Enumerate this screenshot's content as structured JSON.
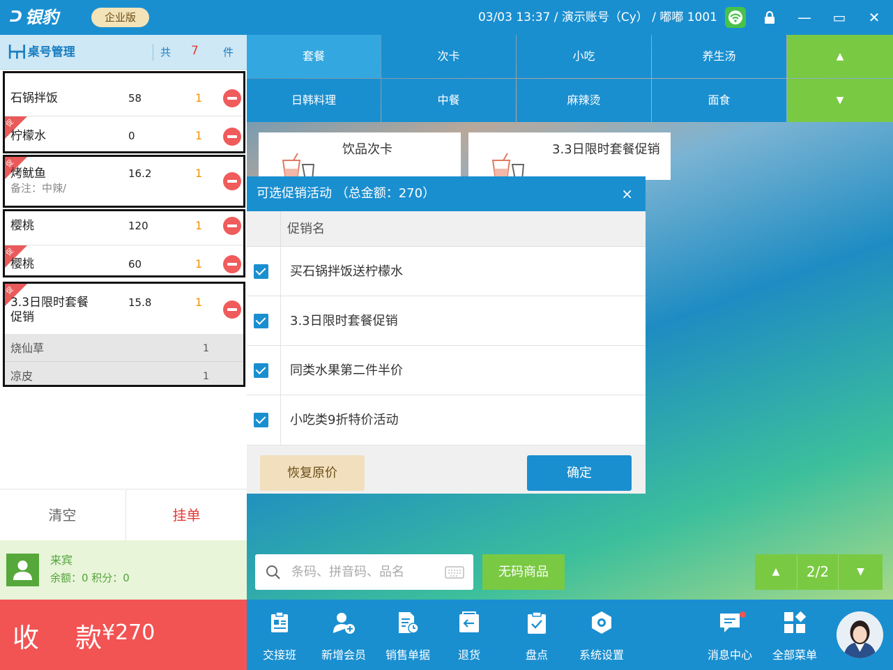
{
  "app": {
    "brand": "银豹",
    "edition": "企业版",
    "status_text": "03/03 13:37 / 演示账号（Cy） / 嘟嘟 1001"
  },
  "window": {
    "min": "—",
    "max": "▭",
    "close": "✕"
  },
  "order_panel": {
    "title": "桌号管理",
    "total_prefix": "共",
    "total_count": "7",
    "total_unit": "件",
    "items": [
      {
        "name": "石锅拌饭",
        "price": "58",
        "qty": "1"
      },
      {
        "name": "柠檬水",
        "price": "0",
        "qty": "1",
        "tag": "促"
      },
      {
        "name": "烤鱿鱼",
        "price": "16.2",
        "qty": "1",
        "tag": "促",
        "note": "备注：中辣/"
      },
      {
        "name": "樱桃",
        "price": "120",
        "qty": "1"
      },
      {
        "name": "樱桃",
        "price": "60",
        "qty": "1",
        "tag": "促"
      },
      {
        "name": "3.3日限时套餐促销",
        "name_line1": "3.3日限时套餐",
        "name_line2": "促销",
        "price": "15.8",
        "qty": "1",
        "tag": "促"
      }
    ],
    "sub_items": [
      {
        "name": "烧仙草",
        "qty": "1"
      },
      {
        "name": "凉皮",
        "qty": "1"
      }
    ],
    "clear_label": "清空",
    "hold_label": "挂单"
  },
  "member": {
    "name": "来宾",
    "info": "余额：0  积分：0"
  },
  "pay": {
    "label": "收 款",
    "amount": "¥270"
  },
  "categories": {
    "row1": [
      "套餐",
      "次卡",
      "小吃",
      "养生汤"
    ],
    "row2": [
      "日韩料理",
      "中餐",
      "麻辣烫",
      "面食"
    ],
    "active": "套餐"
  },
  "products": [
    {
      "name": "饮品次卡"
    },
    {
      "name": "3.3日限时套餐促销"
    }
  ],
  "promo_dialog": {
    "title": "可选促销活动 （总金额：270）",
    "close": "×",
    "column_header": "促销名",
    "promotions": [
      {
        "name": "买石锅拌饭送柠檬水",
        "checked": true
      },
      {
        "name": "3.3日限时套餐促销",
        "checked": true
      },
      {
        "name": "同类水果第二件半价",
        "checked": true
      },
      {
        "name": "小吃类9折特价活动",
        "checked": true
      }
    ],
    "restore_label": "恢复原价",
    "confirm_label": "确定"
  },
  "search": {
    "placeholder": "条码、拼音码、品名"
  },
  "no_barcode_label": "无码商品",
  "pager": {
    "page": "2/2"
  },
  "toolbar": [
    {
      "label": "交接班",
      "icon": "shift-handover-icon"
    },
    {
      "label": "新增会员",
      "icon": "add-member-icon"
    },
    {
      "label": "销售单据",
      "icon": "sales-docs-icon"
    },
    {
      "label": "退货",
      "icon": "return-icon"
    },
    {
      "label": "盘点",
      "icon": "inventory-check-icon"
    },
    {
      "label": "系统设置",
      "icon": "settings-icon"
    },
    {
      "label": "消息中心",
      "icon": "message-icon"
    },
    {
      "label": "全部菜单",
      "icon": "all-menu-icon"
    }
  ],
  "colors": {
    "primary": "#1a8fd0",
    "green": "#7ac943",
    "red": "#f25353",
    "orange": "#f39200"
  }
}
